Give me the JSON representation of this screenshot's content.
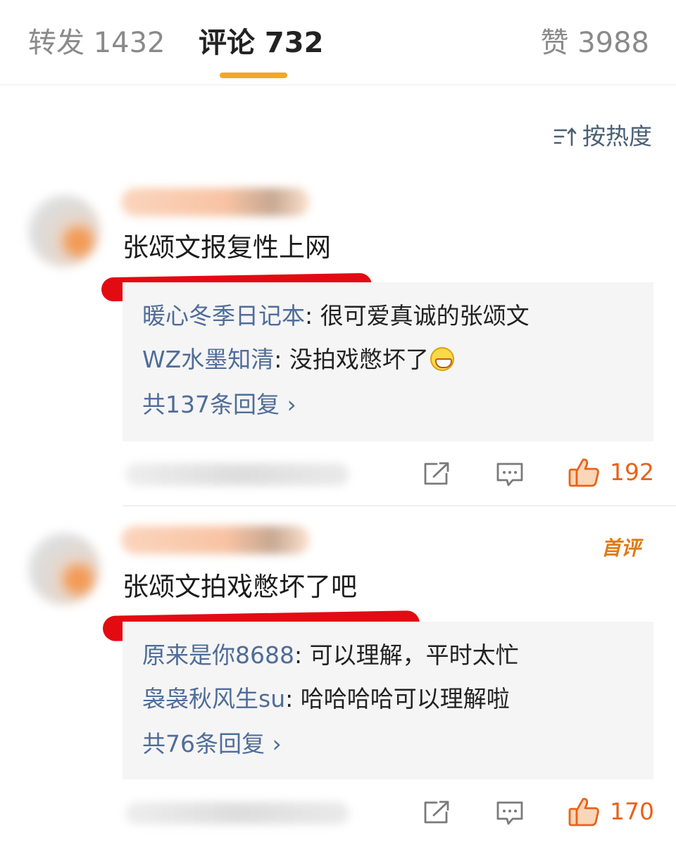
{
  "tabs": [
    {
      "label": "转发 1432"
    },
    {
      "label": "评论 732"
    },
    {
      "label": "赞 3988"
    }
  ],
  "sort": {
    "label": "按热度"
  },
  "comments": [
    {
      "text": "张颂文报复性上网",
      "replies": [
        {
          "name": "暖心冬季日记本",
          "text": ": 很可爱真诚的张颂文"
        },
        {
          "name": "WZ水墨知清",
          "text": ": 没拍戏憋坏了",
          "emoji": "grin-emoji"
        }
      ],
      "reply_total": "共137条回复 ›",
      "likes": "192"
    },
    {
      "badge": "首评",
      "text": "张颂文拍戏憋坏了吧",
      "replies": [
        {
          "name": "原来是你8688",
          "text": ": 可以理解，平时太忙"
        },
        {
          "name": "袅袅秋风生su",
          "text": ": 哈哈哈哈可以理解啦"
        }
      ],
      "reply_total": "共76条回复 ›",
      "likes": "170"
    }
  ],
  "colors": {
    "accent": "#f5a623",
    "link": "#4f6d99",
    "like": "#e8621a",
    "marker": "#e30b12"
  }
}
